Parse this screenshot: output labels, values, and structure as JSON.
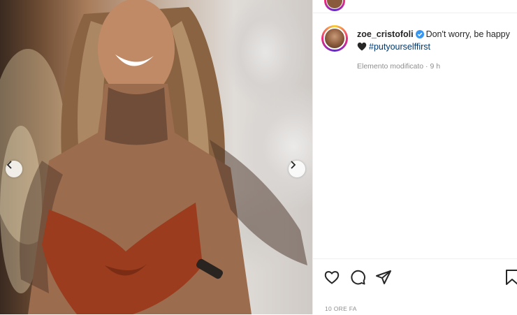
{
  "post": {
    "username": "zoe_cristofoli",
    "caption_text": "Don't worry, be happy",
    "hashtag": "#putyourselffirst",
    "edited_label": "Elemento modificato · 9 h",
    "timestamp": "10 ORE FA"
  },
  "carousel": {
    "prev_icon": "chevron-left-icon",
    "next_icon": "chevron-right-icon"
  },
  "actions": {
    "icons": [
      "heart-icon",
      "comment-icon",
      "share-icon",
      "bookmark-icon"
    ]
  },
  "colors": {
    "verified": "#3897f0",
    "hashtag": "#00376b",
    "muted": "#8e8e8e",
    "text": "#262626"
  }
}
